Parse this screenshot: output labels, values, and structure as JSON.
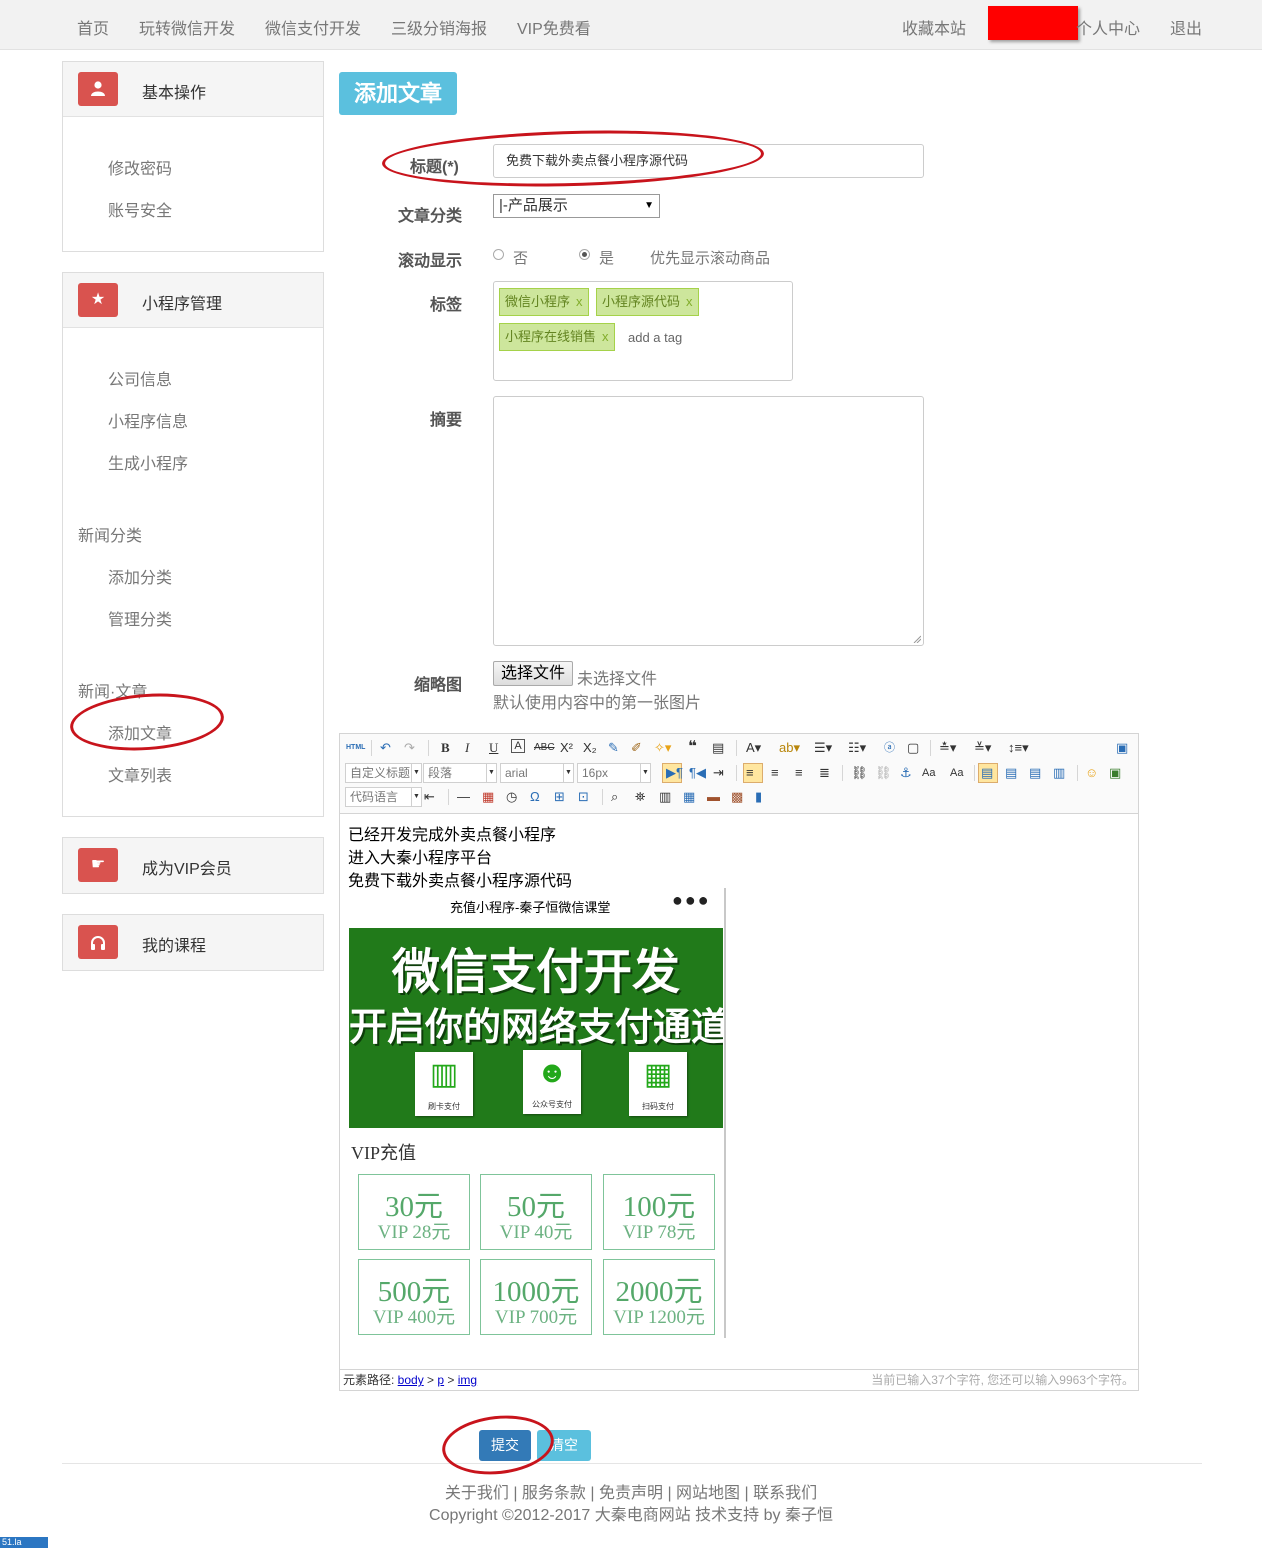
{
  "nav": {
    "left": [
      "首页",
      "玩转微信开发",
      "微信支付开发",
      "三级分销海报",
      "VIP免费看"
    ],
    "bookmark": "收藏本站",
    "user_center": "个人中心",
    "logout": "退出"
  },
  "sidebar": {
    "basic": {
      "title": "基本操作",
      "items": [
        "修改密码",
        "账号安全"
      ]
    },
    "miniapp": {
      "title": "小程序管理",
      "items": [
        "公司信息",
        "小程序信息",
        "生成小程序"
      ],
      "news_category": {
        "title": "新闻分类",
        "items": [
          "添加分类",
          "管理分类"
        ]
      },
      "news_article": {
        "title": "新闻·文章",
        "items": [
          "添加文章",
          "文章列表"
        ]
      }
    },
    "vip": {
      "title": "成为VIP会员"
    },
    "courses": {
      "title": "我的课程"
    }
  },
  "form": {
    "page_title": "添加文章",
    "title_label": "标题(*)",
    "title_value": "免费下载外卖点餐小程序源代码",
    "category_label": "文章分类",
    "category_value": "|-产品展示",
    "scroll_label": "滚动显示",
    "scroll_no": "否",
    "scroll_yes": "是",
    "scroll_selected": "是",
    "scroll_hint": "优先显示滚动商品",
    "tags_label": "标签",
    "tags": [
      "微信小程序",
      "小程序源代码",
      "小程序在线销售"
    ],
    "tag_remove": "x",
    "tag_placeholder": "add a tag",
    "summary_label": "摘要",
    "thumb_label": "缩略图",
    "file_button": "选择文件",
    "file_status": "未选择文件",
    "thumb_hint": "默认使用内容中的第一张图片"
  },
  "editor": {
    "toolbar": {
      "html_button": "HTML",
      "heading_combo": "自定义标题",
      "paragraph_combo": "段落",
      "font_combo": "arial",
      "size_combo": "16px",
      "code_combo": "代码语言"
    },
    "content_lines": [
      "已经开发完成外卖点餐小程序",
      "进入大秦小程序平台",
      "免费下载外卖点餐小程序源代码"
    ],
    "phone": {
      "title": "充值小程序-秦子恒微信课堂",
      "menu_dots": "●●●",
      "banner_line1": "微信支付开发",
      "banner_line2": "开启你的网络支付通道",
      "pay_options": [
        "刷卡支付",
        "公众号支付",
        "扫码支付"
      ],
      "vip_label": "VIP充值",
      "prices": [
        {
          "amount": "30元",
          "vip": "VIP 28元"
        },
        {
          "amount": "50元",
          "vip": "VIP 40元"
        },
        {
          "amount": "100元",
          "vip": "VIP 78元"
        },
        {
          "amount": "500元",
          "vip": "VIP 400元"
        },
        {
          "amount": "1000元",
          "vip": "VIP 700元"
        },
        {
          "amount": "2000元",
          "vip": "VIP 1200元"
        }
      ]
    },
    "status": {
      "path_label": "元素路径: ",
      "path": [
        "body",
        "p",
        "img"
      ],
      "path_sep": " > ",
      "count_text": "当前已输入37个字符, 您还可以输入9963个字符。"
    }
  },
  "actions": {
    "submit": "提交",
    "clear": "清空"
  },
  "footer": {
    "links": [
      "关于我们",
      "服务条款",
      "免责声明",
      "网站地图",
      "联系我们"
    ],
    "separator": " | ",
    "copyright": "Copyright ©2012-2017 大秦电商网站 技术支持 by 秦子恒"
  },
  "counter_badge": "51.la",
  "colors": {
    "accent_red": "#d9534f",
    "info_blue": "#5bc0de",
    "primary_blue": "#337ab7",
    "tag_green": "#cde69c",
    "annotation_red": "#c8141c"
  }
}
